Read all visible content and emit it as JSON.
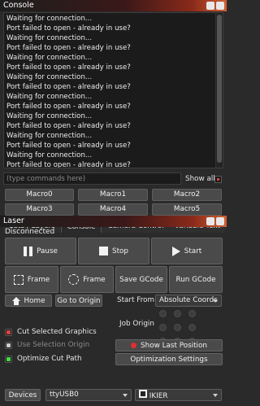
{
  "console": {
    "title": "Console",
    "lines": [
      "Waiting for connection...",
      "Port failed to open - already in use?",
      "Waiting for connection...",
      "Port failed to open - already in use?",
      "Waiting for connection...",
      "Port failed to open - already in use?",
      "Waiting for connection...",
      "Port failed to open - already in use?",
      "Waiting for connection...",
      "Port failed to open - already in use?",
      "Waiting for connection...",
      "Port failed to open - already in use?",
      "Waiting for connection...",
      "Port failed to open - already in use?",
      "Waiting for connection...",
      "Port failed to open - already in use?"
    ],
    "command_placeholder": "(type commands here)",
    "show_all_label": "Show all",
    "macros": [
      "Macro0",
      "Macro1",
      "Macro2",
      "Macro3",
      "Macro4",
      "Macro5"
    ]
  },
  "tabs": [
    "Cuts / Layers",
    "Console",
    "Camera Control",
    "Variable Text"
  ],
  "laser": {
    "title": "Laser",
    "status": "Disconnected",
    "pause_label": "Pause",
    "stop_label": "Stop",
    "start_label": "Start",
    "frame_rect_label": "Frame",
    "frame_circle_label": "Frame",
    "save_gcode_label": "Save GCode",
    "run_gcode_label": "Run GCode",
    "home_label": "Home",
    "go_to_origin_label": "Go to Origin",
    "start_from_label": "Start From:",
    "start_from_value": "Absolute Coords",
    "job_origin_label": "Job Origin",
    "cut_selected_label": "Cut Selected Graphics",
    "use_selection_origin_label": "Use Selection Origin",
    "show_last_position_label": "Show Last Position",
    "optimize_cut_path_label": "Optimize Cut Path",
    "optimization_settings_label": "Optimization Settings",
    "devices_label": "Devices",
    "port_value": "ttyUSB0",
    "machine_value": "IKIER"
  }
}
